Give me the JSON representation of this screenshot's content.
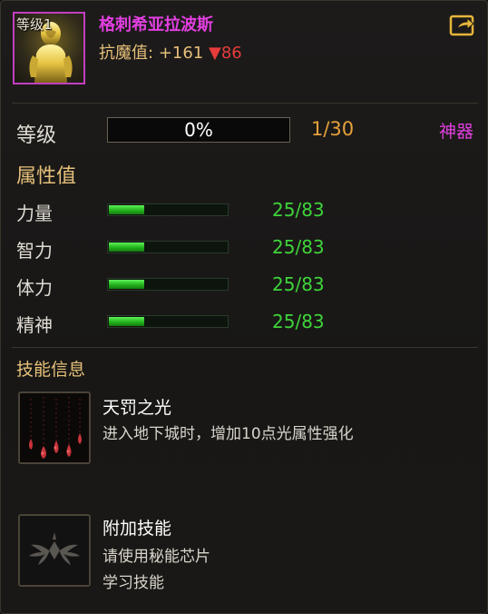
{
  "header": {
    "portrait_level": "等级1",
    "item_name": "格刺希亚拉波斯",
    "resist_label": "抗魔值:",
    "resist_plus": "+161",
    "resist_down_arrow": "▼",
    "resist_down_value": "86",
    "share_icon": "export-share-icon"
  },
  "level": {
    "label": "等级",
    "progress_fraction": 0.0,
    "progress_text": "0%",
    "value": "1/30",
    "grade": "神器"
  },
  "attributes": {
    "title": "属性值",
    "stats": [
      {
        "label": "力量",
        "value": "25/83",
        "fraction": 0.3
      },
      {
        "label": "智力",
        "value": "25/83",
        "fraction": 0.3
      },
      {
        "label": "体力",
        "value": "25/83",
        "fraction": 0.3
      },
      {
        "label": "精神",
        "value": "25/83",
        "fraction": 0.3
      }
    ]
  },
  "skills": {
    "title": "技能信息",
    "items": [
      {
        "name": "天罚之光",
        "desc_line1": "进入地下城时，增加10点光属性强化",
        "desc_line2": "",
        "icon": "blood-drops-icon"
      },
      {
        "name": "附加技能",
        "desc_line1": "请使用秘能芯片",
        "desc_line2": "学习技能",
        "icon": "wing-emblem-icon"
      }
    ]
  },
  "colors": {
    "item_name": "#e23fe0",
    "gold": "#e6c07a",
    "green_value": "#3fd43a",
    "red_down": "#e63c3c"
  }
}
